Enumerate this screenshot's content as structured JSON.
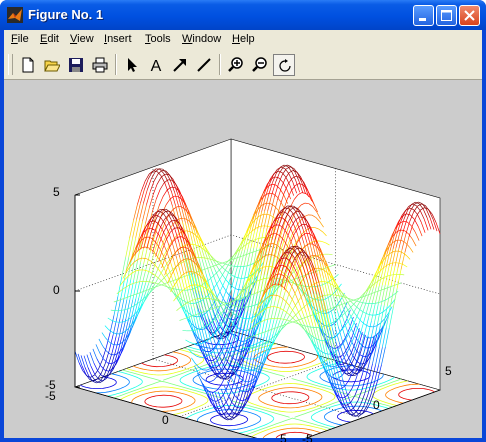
{
  "window": {
    "title": "Figure No. 1",
    "titlebar_color": "#0054e3",
    "buttons": [
      "minimize",
      "maximize",
      "close"
    ]
  },
  "menu": {
    "items": [
      "File",
      "Edit",
      "View",
      "Insert",
      "Tools",
      "Window",
      "Help"
    ]
  },
  "toolbar": {
    "tools": [
      {
        "name": "new-figure",
        "icon": "new-file-icon"
      },
      {
        "name": "open",
        "icon": "open-folder-icon"
      },
      {
        "name": "save",
        "icon": "save-disk-icon"
      },
      {
        "name": "print",
        "icon": "printer-icon"
      },
      {
        "name": "edit-plot",
        "icon": "arrow-pointer-icon"
      },
      {
        "name": "insert-text",
        "icon": "text-A-icon",
        "glyph": "A"
      },
      {
        "name": "insert-arrow",
        "icon": "arrow-icon"
      },
      {
        "name": "insert-line",
        "icon": "line-icon"
      },
      {
        "name": "zoom-in",
        "icon": "zoom-in-icon"
      },
      {
        "name": "zoom-out",
        "icon": "zoom-out-icon"
      },
      {
        "name": "rotate-3d",
        "icon": "rotate-icon",
        "pressed": true
      }
    ]
  },
  "figure": {
    "background": "#cccccc",
    "axes_background": "#ffffff",
    "plot": "3D mesh surface with contour projection",
    "colormap": "jet"
  },
  "chart_data": {
    "type": "surface",
    "x_ticks": [
      "-5",
      "0",
      "5"
    ],
    "y_ticks": [
      "-5",
      "0",
      "5"
    ],
    "z_ticks": [
      "-5",
      "0",
      "5"
    ],
    "xlim": [
      -5,
      5
    ],
    "ylim": [
      -5,
      5
    ],
    "zlim": [
      -5,
      5
    ],
    "grid": true
  }
}
